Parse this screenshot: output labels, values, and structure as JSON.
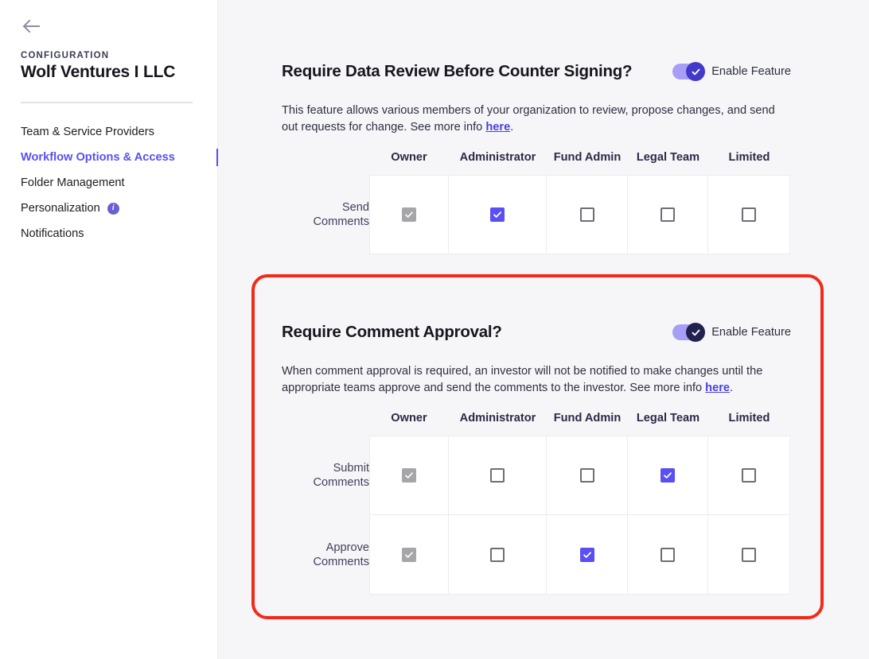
{
  "sidebar": {
    "back_icon": "back-arrow-icon",
    "eyebrow": "CONFIGURATION",
    "org_name": "Wolf Ventures I LLC",
    "items": [
      {
        "label": "Team & Service Providers",
        "active": false,
        "info": false
      },
      {
        "label": "Workflow Options & Access",
        "active": true,
        "info": false
      },
      {
        "label": "Folder Management",
        "active": false,
        "info": false
      },
      {
        "label": "Personalization",
        "active": false,
        "info": true
      },
      {
        "label": "Notifications",
        "active": false,
        "info": false
      }
    ],
    "info_icon_glyph": "i"
  },
  "colors": {
    "accent": "#5A4FF3",
    "accent_dark": "#4339C9",
    "toggle_track": "#A79EF5",
    "toggle_knob_dark": "#21214D",
    "locked_checkbox": "#A6A6A9",
    "highlight_border": "#F42A18",
    "page_background": "#F6F6F9",
    "sidebar_background": "#FFFFFF"
  },
  "columns": [
    "Owner",
    "Administrator",
    "Fund Admin",
    "Legal Team",
    "Limited"
  ],
  "sections": [
    {
      "id": "data-review",
      "title": "Require Data Review Before Counter Signing?",
      "toggle": {
        "label": "Enable Feature",
        "enabled": true,
        "style": "light"
      },
      "description_before": "This feature allows various members of your organization to review, propose changes, and send out requests for change. See more info ",
      "description_link": "here",
      "description_after": ".",
      "rows": [
        {
          "label_line1": "Send",
          "label_line2": "Comments",
          "states": [
            "locked",
            "checked",
            "empty",
            "empty",
            "empty"
          ]
        }
      ]
    },
    {
      "id": "comment-approval",
      "title": "Require Comment Approval?",
      "toggle": {
        "label": "Enable Feature",
        "enabled": true,
        "style": "dark"
      },
      "description_before": "When comment approval is required, an investor will not be notified to make changes until the appropriate teams approve and send the comments to the investor. See more info ",
      "description_link": "here",
      "description_after": ".",
      "rows": [
        {
          "label_line1": "Submit",
          "label_line2": "Comments",
          "states": [
            "locked",
            "empty",
            "empty",
            "checked",
            "empty"
          ]
        },
        {
          "label_line1": "Approve",
          "label_line2": "Comments",
          "states": [
            "locked",
            "empty",
            "checked",
            "empty",
            "empty"
          ]
        }
      ]
    }
  ]
}
